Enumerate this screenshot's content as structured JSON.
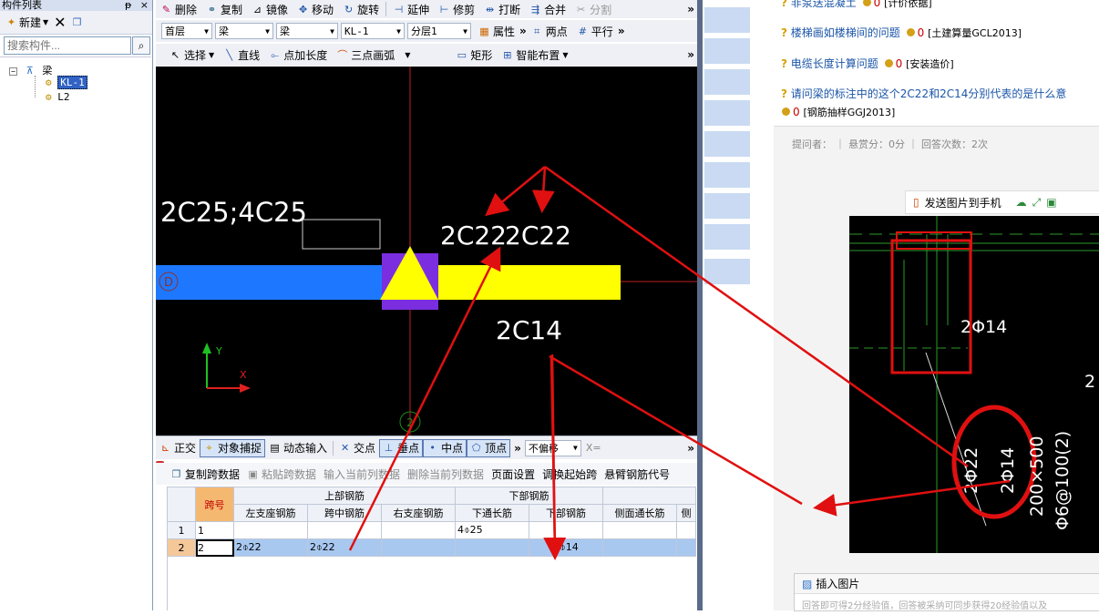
{
  "left_panel": {
    "title": "构件列表",
    "pin": "ᵽ",
    "close": "×",
    "new_label": "新建",
    "search_placeholder": "搜索构件...",
    "tree": [
      {
        "label": "梁",
        "level": 0
      },
      {
        "label": "KL-1",
        "level": 1,
        "selected": true
      },
      {
        "label": "L2",
        "level": 1
      }
    ]
  },
  "toolbar1": [
    "删除",
    "复制",
    "镜像",
    "移动",
    "旋转",
    "延伸",
    "修剪",
    "打断",
    "合并",
    "分割"
  ],
  "toolbar2": {
    "selects": [
      "首层",
      "梁",
      "梁",
      "KL-1",
      "分层1"
    ],
    "buttons": [
      "属性",
      "两点",
      "平行"
    ]
  },
  "toolbar3": [
    "选择",
    "直线",
    "点加长度",
    "三点画弧",
    "矩形",
    "智能布置"
  ],
  "canvas": {
    "label_top_left": "2C25;4C25",
    "label_top": "2C22",
    "label_top2": "2C22",
    "label_bottom": "2C14",
    "axis_label": "D",
    "axis_num": "2",
    "axis_x": "X",
    "axis_y": "Y"
  },
  "snapbar": [
    "正交",
    "对象捕捉",
    "动态输入",
    "交点",
    "垂点",
    "中点",
    "顶点",
    "不偏移",
    "X="
  ],
  "grid_toolbar": [
    "复制跨数据",
    "粘贴跨数据",
    "输入当前列数据",
    "删除当前列数据",
    "页面设置",
    "调换起始跨",
    "悬臂钢筋代号"
  ],
  "grid": {
    "group_headers": {
      "span": "跨号",
      "top": "上部钢筋",
      "bottom": "下部钢筋"
    },
    "columns": [
      "左支座钢筋",
      "跨中钢筋",
      "右支座钢筋",
      "下通长筋",
      "下部钢筋",
      "侧面通长筋",
      "侧"
    ],
    "rows": [
      {
        "num": "1",
        "span": "1",
        "cells": [
          "",
          "",
          "",
          "4⌽25",
          "",
          "",
          ""
        ]
      },
      {
        "num": "2",
        "span": "2",
        "cells": [
          "2⌽22",
          "2⌽22",
          "",
          "",
          "2⌽14",
          "",
          ""
        ]
      }
    ]
  },
  "right_panel": {
    "questions": [
      {
        "title": "非泵送混凝土",
        "points": "0",
        "tag": "[计价依据]"
      },
      {
        "title": "楼梯画如楼梯间的问题",
        "points": "0",
        "tag": "[土建算量GCL2013]"
      },
      {
        "title": "电缆长度计算问题",
        "points": "0",
        "tag": "[安装造价]"
      },
      {
        "title": "请问梁的标注中的这个2C22和2C14分别代表的是什么意",
        "points": "0",
        "tag": "[钢筋抽样GGJ2013]"
      }
    ],
    "meta": "提问者：  ｜ 悬赏分：0分  ｜ 回答次数：2次",
    "send_to_phone": "发送图片到手机",
    "insert_image": "插入图片",
    "answer_hint": "回答即可得2分经验值，回答被采纳可同步获得20经验值以及",
    "drawing": {
      "label1": "2Φ14",
      "label2": "2Φ22",
      "label3": "2Φ14",
      "label4": "200×500",
      "label5": "Φ6@100(2)",
      "label6": "2"
    }
  },
  "colors": {
    "beam_blue": "#1e78ff",
    "beam_yellow": "#ffff00",
    "arrow_red": "#e01010",
    "selection": "#a8c8f0"
  }
}
